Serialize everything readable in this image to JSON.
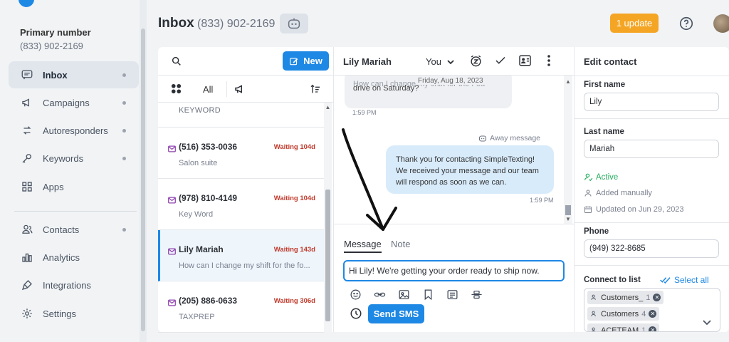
{
  "nav": {
    "primary_label": "Primary number",
    "primary_value": "(833) 902-2169",
    "items": [
      {
        "label": "Inbox",
        "icon": "inbox-icon"
      },
      {
        "label": "Campaigns",
        "icon": "megaphone-icon"
      },
      {
        "label": "Autoresponders",
        "icon": "autoresponder-icon"
      },
      {
        "label": "Keywords",
        "icon": "key-icon"
      },
      {
        "label": "Apps",
        "icon": "apps-grid-icon"
      },
      {
        "label": "Contacts",
        "icon": "contacts-icon"
      },
      {
        "label": "Analytics",
        "icon": "analytics-icon"
      },
      {
        "label": "Integrations",
        "icon": "integrations-icon"
      },
      {
        "label": "Settings",
        "icon": "gear-icon"
      }
    ]
  },
  "header": {
    "title": "Inbox",
    "phone": "(833) 902-2169",
    "update_label": "1 update"
  },
  "list": {
    "new_label": "New",
    "filter_all": "All",
    "keyword_row": "KEYWORD",
    "conversations": [
      {
        "name": "(516) 353-0036",
        "waiting": "Waiting 104d",
        "sub": "Salon suite"
      },
      {
        "name": "(978) 810-4149",
        "waiting": "Waiting 104d",
        "sub": "Key Word"
      },
      {
        "name": "Lily Mariah",
        "waiting": "Waiting 143d",
        "sub": "How can I change my shift for the fo..."
      },
      {
        "name": "(205) 886-0633",
        "waiting": "Waiting 306d",
        "sub": "TAXPREP"
      }
    ]
  },
  "chat": {
    "contact_name": "Lily Mariah",
    "assignee": "You",
    "incoming_line1": "How can I change my shift for the Fou",
    "incoming_line2": "drive on Saturday?",
    "date_separator": "Friday, Aug 18, 2023",
    "incoming_time": "1:59 PM",
    "away_label": "Away message",
    "outgoing_text": "Thank you for contacting SimpleTexting! We received your message and our team will respond as soon as we can.",
    "outgoing_time": "1:59 PM"
  },
  "compose": {
    "tab_message": "Message",
    "tab_note": "Note",
    "input_value": "Hi Lily! We're getting your order ready to ship now.",
    "send_label": "Send SMS"
  },
  "edit_contact": {
    "title": "Edit contact",
    "first_name_label": "First name",
    "first_name": "Lily",
    "last_name_label": "Last name",
    "last_name": "Mariah",
    "status": "Active",
    "added": "Added manually",
    "updated": "Updated on Jun 29, 2023",
    "phone_label": "Phone",
    "phone": "(949) 322-8685",
    "connect_label": "Connect to list",
    "select_all": "Select all",
    "lists": [
      {
        "name": "Customers_",
        "count": "1"
      },
      {
        "name": "Customers",
        "count": "4"
      },
      {
        "name": "ACETEAM",
        "count": "1"
      }
    ]
  },
  "colors": {
    "accent": "#1e88e5",
    "update_badge": "#f5a524",
    "waiting": "#c0392b",
    "active": "#27ae60"
  }
}
